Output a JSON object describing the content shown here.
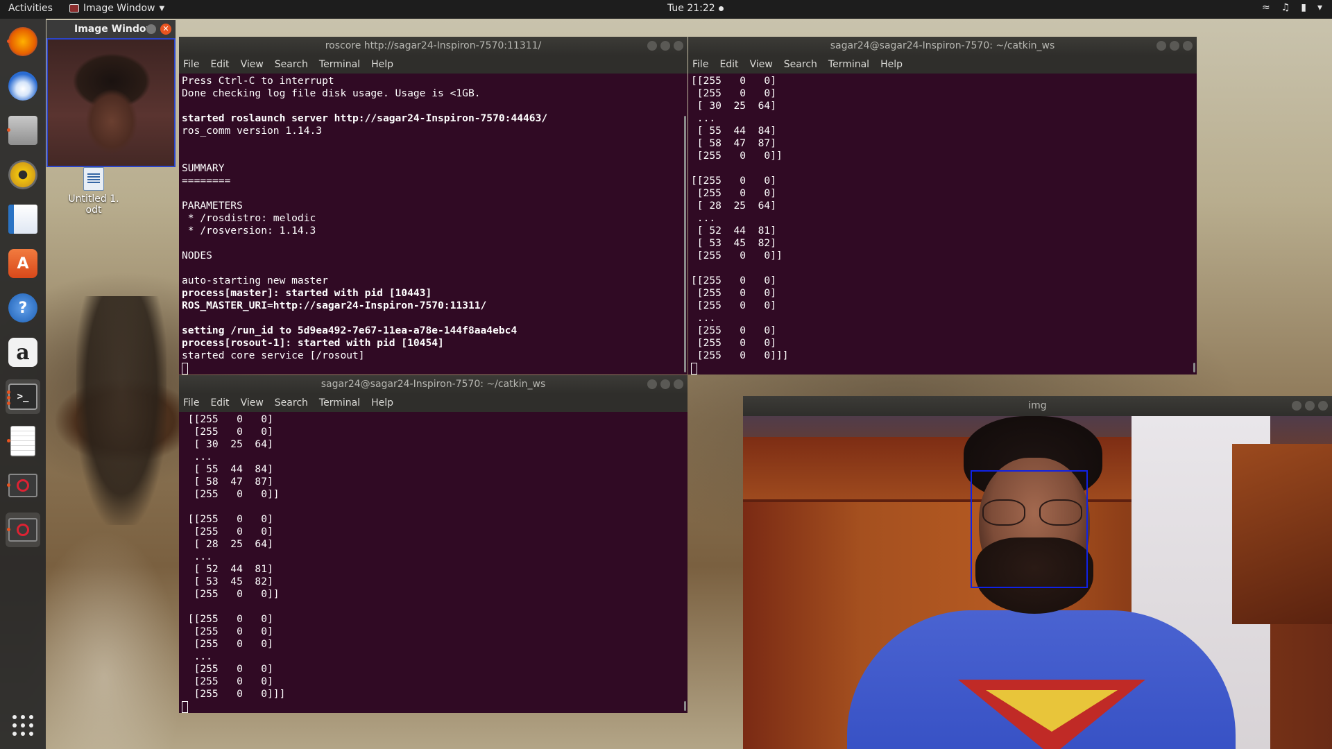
{
  "topbar": {
    "activities": "Activities",
    "app_menu": "Image Window",
    "clock": "Tue 21:22"
  },
  "dock": {
    "items": [
      {
        "name": "firefox-icon",
        "color": "#e66000"
      },
      {
        "name": "thunderbird-icon",
        "color": "#2a6bd1"
      },
      {
        "name": "files-icon",
        "color": "#8a8a8a"
      },
      {
        "name": "rhythmbox-icon",
        "color": "#c9a227"
      },
      {
        "name": "libreoffice-writer-icon",
        "color": "#2a73c4"
      },
      {
        "name": "software-center-icon",
        "color": "#e95420"
      },
      {
        "name": "help-icon",
        "color": "#3584e4"
      },
      {
        "name": "amazon-icon",
        "color": "#f2f2f2"
      },
      {
        "name": "terminal-icon",
        "color": "#333333"
      },
      {
        "name": "text-editor-icon",
        "color": "#f5f5f5"
      },
      {
        "name": "unknown-app-icon",
        "color": "#c62828"
      },
      {
        "name": "unknown-app-icon",
        "color": "#c62828"
      }
    ]
  },
  "image_window_small": {
    "title": "Image Window"
  },
  "desktop_icon": {
    "label": "Untitled 1.\nodt"
  },
  "terminal_roscore": {
    "title": "roscore http://sagar24-Inspiron-7570:11311/",
    "menu": [
      "File",
      "Edit",
      "View",
      "Search",
      "Terminal",
      "Help"
    ],
    "lines": [
      {
        "text": "Press Ctrl-C to interrupt",
        "bold": false
      },
      {
        "text": "Done checking log file disk usage. Usage is <1GB.",
        "bold": false
      },
      {
        "text": "",
        "bold": false
      },
      {
        "text": "started roslaunch server http://sagar24-Inspiron-7570:44463/",
        "bold": true
      },
      {
        "text": "ros_comm version 1.14.3",
        "bold": false
      },
      {
        "text": "",
        "bold": false
      },
      {
        "text": "",
        "bold": false
      },
      {
        "text": "SUMMARY",
        "bold": false
      },
      {
        "text": "========",
        "bold": false
      },
      {
        "text": "",
        "bold": false
      },
      {
        "text": "PARAMETERS",
        "bold": false
      },
      {
        "text": " * /rosdistro: melodic",
        "bold": false
      },
      {
        "text": " * /rosversion: 1.14.3",
        "bold": false
      },
      {
        "text": "",
        "bold": false
      },
      {
        "text": "NODES",
        "bold": false
      },
      {
        "text": "",
        "bold": false
      },
      {
        "text": "auto-starting new master",
        "bold": false
      },
      {
        "text": "process[master]: started with pid [10443]",
        "bold": true
      },
      {
        "text": "ROS_MASTER_URI=http://sagar24-Inspiron-7570:11311/",
        "bold": true
      },
      {
        "text": "",
        "bold": false
      },
      {
        "text": "setting /run_id to 5d9ea492-7e67-11ea-a78e-144f8aa4ebc4",
        "bold": true
      },
      {
        "text": "process[rosout-1]: started with pid [10454]",
        "bold": true
      },
      {
        "text": "started core service [/rosout]",
        "bold": false
      }
    ]
  },
  "terminal_catkin_top": {
    "title": "sagar24@sagar24-Inspiron-7570: ~/catkin_ws",
    "menu": [
      "File",
      "Edit",
      "View",
      "Search",
      "Terminal",
      "Help"
    ],
    "lines": [
      "[[255   0   0]",
      " [255   0   0]",
      " [ 30  25  64]",
      " ...",
      " [ 55  44  84]",
      " [ 58  47  87]",
      " [255   0   0]]",
      "",
      "[[255   0   0]",
      " [255   0   0]",
      " [ 28  25  64]",
      " ...",
      " [ 52  44  81]",
      " [ 53  45  82]",
      " [255   0   0]]",
      "",
      "[[255   0   0]",
      " [255   0   0]",
      " [255   0   0]",
      " ...",
      " [255   0   0]",
      " [255   0   0]",
      " [255   0   0]]]"
    ]
  },
  "terminal_catkin_bottom": {
    "title": "sagar24@sagar24-Inspiron-7570: ~/catkin_ws",
    "menu": [
      "File",
      "Edit",
      "View",
      "Search",
      "Terminal",
      "Help"
    ],
    "lines": [
      " [[255   0   0]",
      "  [255   0   0]",
      "  [ 30  25  64]",
      "  ...",
      "  [ 55  44  84]",
      "  [ 58  47  87]",
      "  [255   0   0]]",
      "",
      " [[255   0   0]",
      "  [255   0   0]",
      "  [ 28  25  64]",
      "  ...",
      "  [ 52  44  81]",
      "  [ 53  45  82]",
      "  [255   0   0]]",
      "",
      " [[255   0   0]",
      "  [255   0   0]",
      "  [255   0   0]",
      "  ...",
      "  [255   0   0]",
      "  [255   0   0]",
      "  [255   0   0]]]"
    ]
  },
  "image_window_big": {
    "title": "img"
  },
  "colors": {
    "terminal_bg": "#300a24",
    "accent": "#e95420",
    "face_box": "#1022e6"
  }
}
